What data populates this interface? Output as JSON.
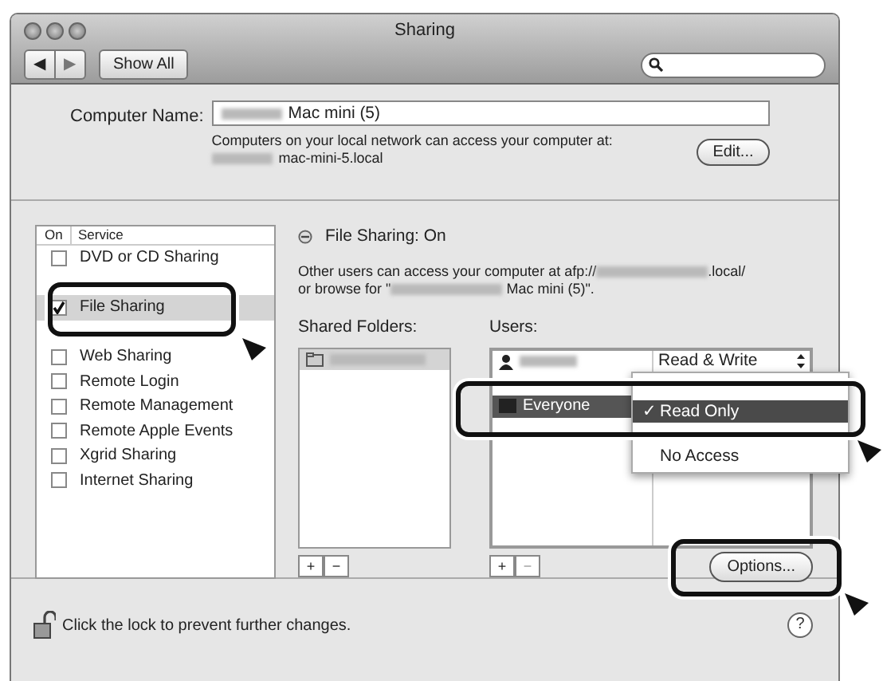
{
  "window": {
    "title": "Sharing"
  },
  "toolbar": {
    "back": "◀",
    "forward": "▶",
    "show_all": "Show All"
  },
  "computer_name": {
    "label": "Computer Name:",
    "value": "Mac mini (5)",
    "note": "Computers on your local network can access your computer at:",
    "address": "mac-mini-5.local",
    "edit_button": "Edit..."
  },
  "services": {
    "columns": [
      "On",
      "Service"
    ],
    "rows": [
      {
        "kind": "service",
        "name": "DVD or CD Sharing",
        "checked": false,
        "selected": false
      },
      {
        "kind": "covered"
      },
      {
        "kind": "service",
        "name": "File Sharing",
        "checked": true,
        "selected": true
      },
      {
        "kind": "covered"
      },
      {
        "kind": "service",
        "name": "Web Sharing",
        "checked": false,
        "selected": false
      },
      {
        "kind": "service",
        "name": "Remote Login",
        "checked": false,
        "selected": false
      },
      {
        "kind": "service",
        "name": "Remote Management",
        "checked": false,
        "selected": false
      },
      {
        "kind": "service",
        "name": "Remote Apple Events",
        "checked": false,
        "selected": false
      },
      {
        "kind": "service",
        "name": "Xgrid Sharing",
        "checked": false,
        "selected": false
      },
      {
        "kind": "service",
        "name": "Internet Sharing",
        "checked": false,
        "selected": false
      }
    ]
  },
  "status": {
    "title": "File Sharing: On",
    "on": true,
    "description": [
      {
        "kind": "text",
        "text": "Other users can access your computer at afp://"
      },
      {
        "kind": "blur"
      },
      {
        "kind": "text",
        "text": ".local/"
      },
      {
        "kind": "break"
      },
      {
        "kind": "text",
        "text": "or browse for \""
      },
      {
        "kind": "blur"
      },
      {
        "kind": "text",
        "text": " Mac mini (5)\"."
      }
    ]
  },
  "shared_folders": {
    "label": "Shared Folders:",
    "items": [
      {
        "selected": true
      }
    ],
    "add": "+",
    "remove": "−"
  },
  "users": {
    "label": "Users:",
    "rows": [
      {
        "kind": "user",
        "permission": "Read & Write",
        "selected": false
      },
      {
        "kind": "covered"
      },
      {
        "kind": "group",
        "name": "Everyone",
        "selected": true
      }
    ],
    "add": "+",
    "remove": "−"
  },
  "permission_menu": {
    "check_mark": "✓",
    "items": [
      {
        "kind": "covered"
      },
      {
        "kind": "option",
        "label": "Read Only",
        "checked": true,
        "selected": true
      },
      {
        "kind": "covered"
      },
      {
        "kind": "option",
        "label": "No Access",
        "checked": false,
        "selected": false
      }
    ]
  },
  "options_button": "Options...",
  "lock": {
    "locked": false,
    "text": "Click the lock to prevent further changes."
  },
  "help": "?"
}
